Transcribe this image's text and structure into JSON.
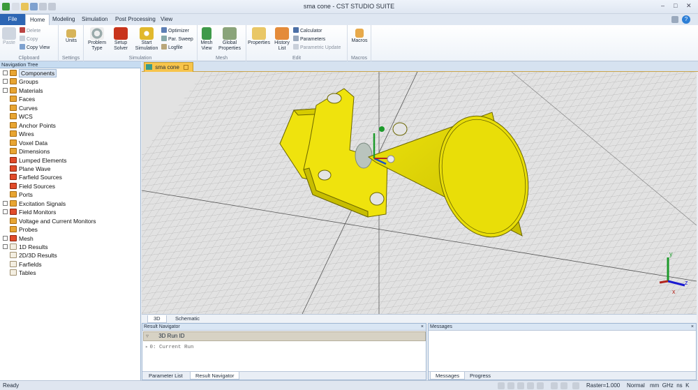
{
  "app": {
    "title": "sma cone - CST STUDIO SUITE"
  },
  "colors": {
    "accent": "#2d66b4",
    "model": "#f2ea0f",
    "model_edge": "#6a6500",
    "doc_tab": "#f7c44b"
  },
  "ribbon_tabs": [
    "File",
    "Home",
    "Modeling",
    "Simulation",
    "Post Processing",
    "View"
  ],
  "ribbon": {
    "clipboard": {
      "paste": "Paste",
      "delete": "Delete",
      "copy": "Copy",
      "copy_view": "Copy View",
      "label": "Clipboard"
    },
    "settings": {
      "units": "Units",
      "label": "Settings"
    },
    "simulation": {
      "problem_type": "Problem Type",
      "setup_solver": "Setup Solver",
      "start_simulation": "Start Simulation",
      "optimizer": "Optimizer",
      "par_sweep": "Par. Sweep",
      "logfile": "Logfile",
      "label": "Simulation"
    },
    "mesh": {
      "mesh_view": "Mesh View",
      "global_properties": "Global Properties",
      "label": "Mesh"
    },
    "edit": {
      "properties": "Properties",
      "history_list": "History List",
      "calculator": "Calculator",
      "parameters": "Parameters",
      "parametric_update": "Parametric Update",
      "label": "Edit"
    },
    "macros": {
      "macros": "Macros",
      "label": "Macros"
    }
  },
  "nav": {
    "title": "Navigation Tree",
    "items": [
      {
        "label": "Components",
        "box": true,
        "icon": "folder",
        "selected": true
      },
      {
        "label": "Groups",
        "box": true,
        "icon": "folder"
      },
      {
        "label": "Materials",
        "box": true,
        "icon": "folder"
      },
      {
        "label": "Faces",
        "box": false,
        "icon": "folder"
      },
      {
        "label": "Curves",
        "box": false,
        "icon": "folder"
      },
      {
        "label": "WCS",
        "box": false,
        "icon": "folder"
      },
      {
        "label": "Anchor Points",
        "box": false,
        "icon": "folder"
      },
      {
        "label": "Wires",
        "box": false,
        "icon": "folder"
      },
      {
        "label": "Voxel Data",
        "box": false,
        "icon": "folder"
      },
      {
        "label": "Dimensions",
        "box": false,
        "icon": "folder"
      },
      {
        "label": "Lumped Elements",
        "box": false,
        "icon": "red"
      },
      {
        "label": "Plane Wave",
        "box": false,
        "icon": "red"
      },
      {
        "label": "Farfield Sources",
        "box": false,
        "icon": "red"
      },
      {
        "label": "Field Sources",
        "box": false,
        "icon": "red"
      },
      {
        "label": "Ports",
        "box": false,
        "icon": "folder"
      },
      {
        "label": "Excitation Signals",
        "box": true,
        "icon": "folder"
      },
      {
        "label": "Field Monitors",
        "box": true,
        "icon": "red"
      },
      {
        "label": "Voltage and Current Monitors",
        "box": false,
        "icon": "folder"
      },
      {
        "label": "Probes",
        "box": false,
        "icon": "folder"
      },
      {
        "label": "Mesh",
        "box": true,
        "icon": "red"
      },
      {
        "label": "1D Results",
        "box": true,
        "icon": "doc"
      },
      {
        "label": "2D/3D Results",
        "box": false,
        "icon": "doc"
      },
      {
        "label": "Farfields",
        "box": false,
        "icon": "doc"
      },
      {
        "label": "Tables",
        "box": false,
        "icon": "doc"
      }
    ]
  },
  "document": {
    "tab": "sma cone"
  },
  "view_tabs": [
    "3D",
    "Schematic"
  ],
  "axes": {
    "x": "x",
    "y": "y",
    "z": "z"
  },
  "result_navigator": {
    "title": "Result Navigator",
    "close": "×",
    "column": "3D Run ID",
    "row": "0: Current Run",
    "tabs": [
      "Parameter List",
      "Result Navigator"
    ]
  },
  "messages": {
    "title": "Messages",
    "close": "×",
    "tabs": [
      "Messages",
      "Progress"
    ]
  },
  "status": {
    "text": "Ready",
    "raster": "Raster=1.000",
    "mode": "Normal",
    "units": "mm  GHz  ns  K"
  }
}
